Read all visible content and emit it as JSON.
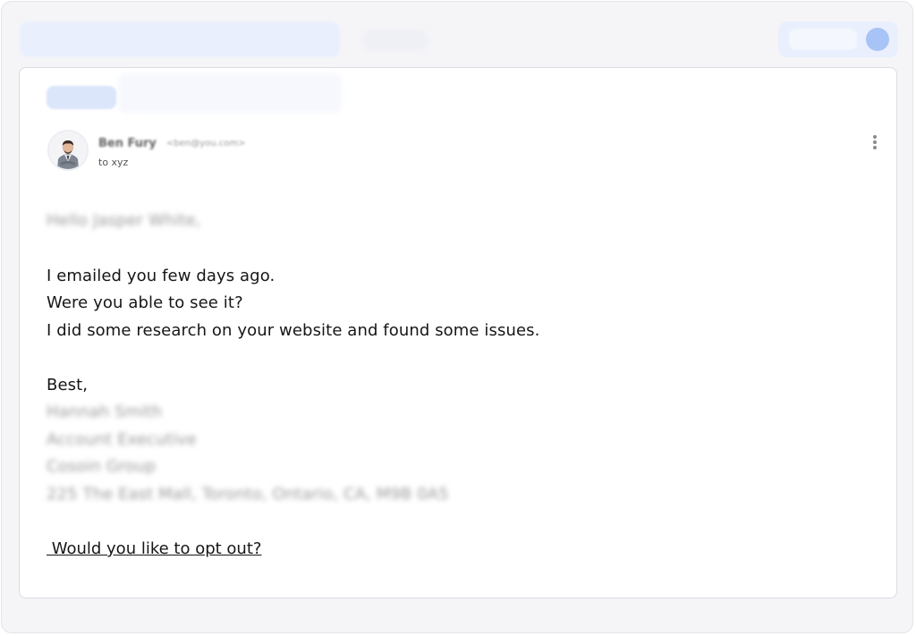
{
  "header": {
    "search_placeholder": "",
    "tab_label": "",
    "account_label": ""
  },
  "email": {
    "subject": "",
    "sender_name": "Ben Fury",
    "sender_email": "<ben@you.com>",
    "to_line": "to xyz",
    "greeting": "Hello Jasper White,",
    "body_lines": [
      "I emailed you few days ago.",
      "Were you able to see it?",
      "I did some research on your website and found some issues."
    ],
    "signoff": "Best,",
    "signature": {
      "name": "Hannah Smith",
      "title": "Account Executive",
      "company": "Cosoin Group",
      "address": "225 The East Mall, Toronto, Ontario, CA, M9B 0A5"
    },
    "opt_out_link": " Would you like to opt out?"
  },
  "icons": {
    "menu": "kebab-menu-icon",
    "avatar": "user-avatar-icon"
  },
  "colors": {
    "accent": "#a8c3f6",
    "toolbar_bg": "#e9effc",
    "text": "#161616"
  }
}
